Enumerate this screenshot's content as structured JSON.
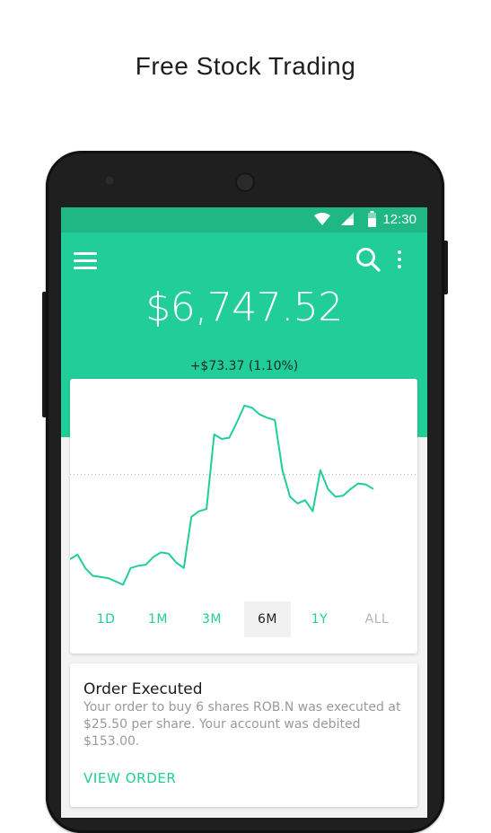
{
  "headline": "Free Stock Trading",
  "status_bar": {
    "time": "12:30",
    "icons": [
      "wifi-icon",
      "signal-icon",
      "battery-icon"
    ]
  },
  "app_bar": {
    "icons": [
      "menu-icon",
      "search-icon",
      "more-vert-icon"
    ]
  },
  "portfolio": {
    "balance": "$6,747.52",
    "change": "+$73.37 (1.10%)"
  },
  "chart_data": {
    "type": "line",
    "x": [
      0,
      1,
      2,
      3,
      4,
      5,
      6,
      7,
      8,
      9,
      10,
      11,
      12,
      13,
      14,
      15,
      16,
      17,
      18,
      19,
      20,
      21,
      22,
      23,
      24,
      25,
      26,
      27,
      28,
      29,
      30,
      31,
      32,
      33,
      34,
      35,
      36,
      37,
      38,
      39,
      40
    ],
    "values": [
      6598,
      6602,
      6590,
      6583,
      6582,
      6581,
      6578,
      6575,
      6590,
      6592,
      6593,
      6600,
      6604,
      6603,
      6595,
      6590,
      6636,
      6641,
      6643,
      6710,
      6706,
      6707,
      6721,
      6736,
      6734,
      6728,
      6725,
      6723,
      6678,
      6654,
      6648,
      6651,
      6641,
      6678,
      6661,
      6654,
      6655,
      6661,
      6666,
      6665,
      6661
    ],
    "baseline": 6674.15,
    "baseline_style": "dotted",
    "grid": false,
    "color": "#21ce99"
  },
  "time_ranges": [
    {
      "label": "1D"
    },
    {
      "label": "1M"
    },
    {
      "label": "3M"
    },
    {
      "label": "6M"
    },
    {
      "label": "1Y"
    },
    {
      "label": "ALL"
    }
  ],
  "selected_range": "6M",
  "order": {
    "title": "Order Executed",
    "body": "Your order to buy 6 shares ROB.N was executed at $25.50 per share. Your account was debited $153.00.",
    "action": "VIEW ORDER"
  },
  "colors": {
    "accent": "#21ce99",
    "status_bar": "#1fb783",
    "text_primary": "#1a1a1a",
    "text_secondary": "#9a9a9a",
    "tab_inactive": "#b5b5b5"
  }
}
